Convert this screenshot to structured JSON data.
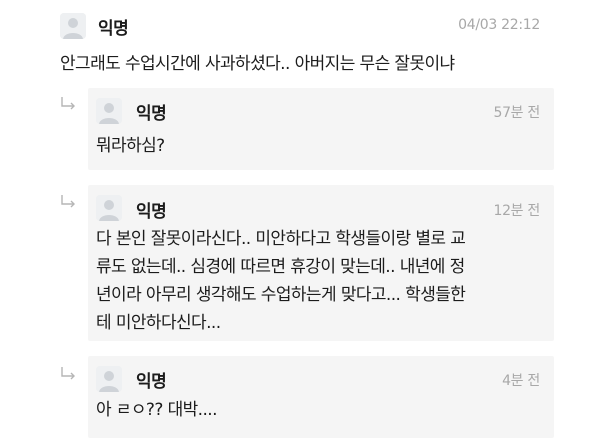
{
  "post": {
    "nickname": "익명",
    "time": "04/03 22:12",
    "text": "안그래도 수업시간에 사과하셨다.. 아버지는 무슨 잘못이냐"
  },
  "replies": [
    {
      "nickname": "익명",
      "time": "57분 전",
      "text": "뭐라하심?"
    },
    {
      "nickname": "익명",
      "time": "12분 전",
      "text": "다 본인 잘못이라신다.. 미안하다고 학생들이랑 별로 교\n류도 없는데.. 심경에 따르면 휴강이 맞는데.. 내년에 정\n년이라 아무리 생각해도 수업하는게 맞다고... 학생들한\n테 미안하다신다..."
    },
    {
      "nickname": "익명",
      "time": "4분 전",
      "text": "아 ㄹㅇ?? 대박...."
    }
  ],
  "icons": {
    "avatar": "default-user-avatar-icon",
    "reply": "reply-arrow-icon"
  },
  "colors": {
    "background": "#ffffff",
    "reply_background": "#f5f5f5",
    "avatar_background": "#eef0f2",
    "avatar_silhouette": "#cfd3d8",
    "text": "#1c1c1c",
    "time": "#a8a8a8"
  }
}
